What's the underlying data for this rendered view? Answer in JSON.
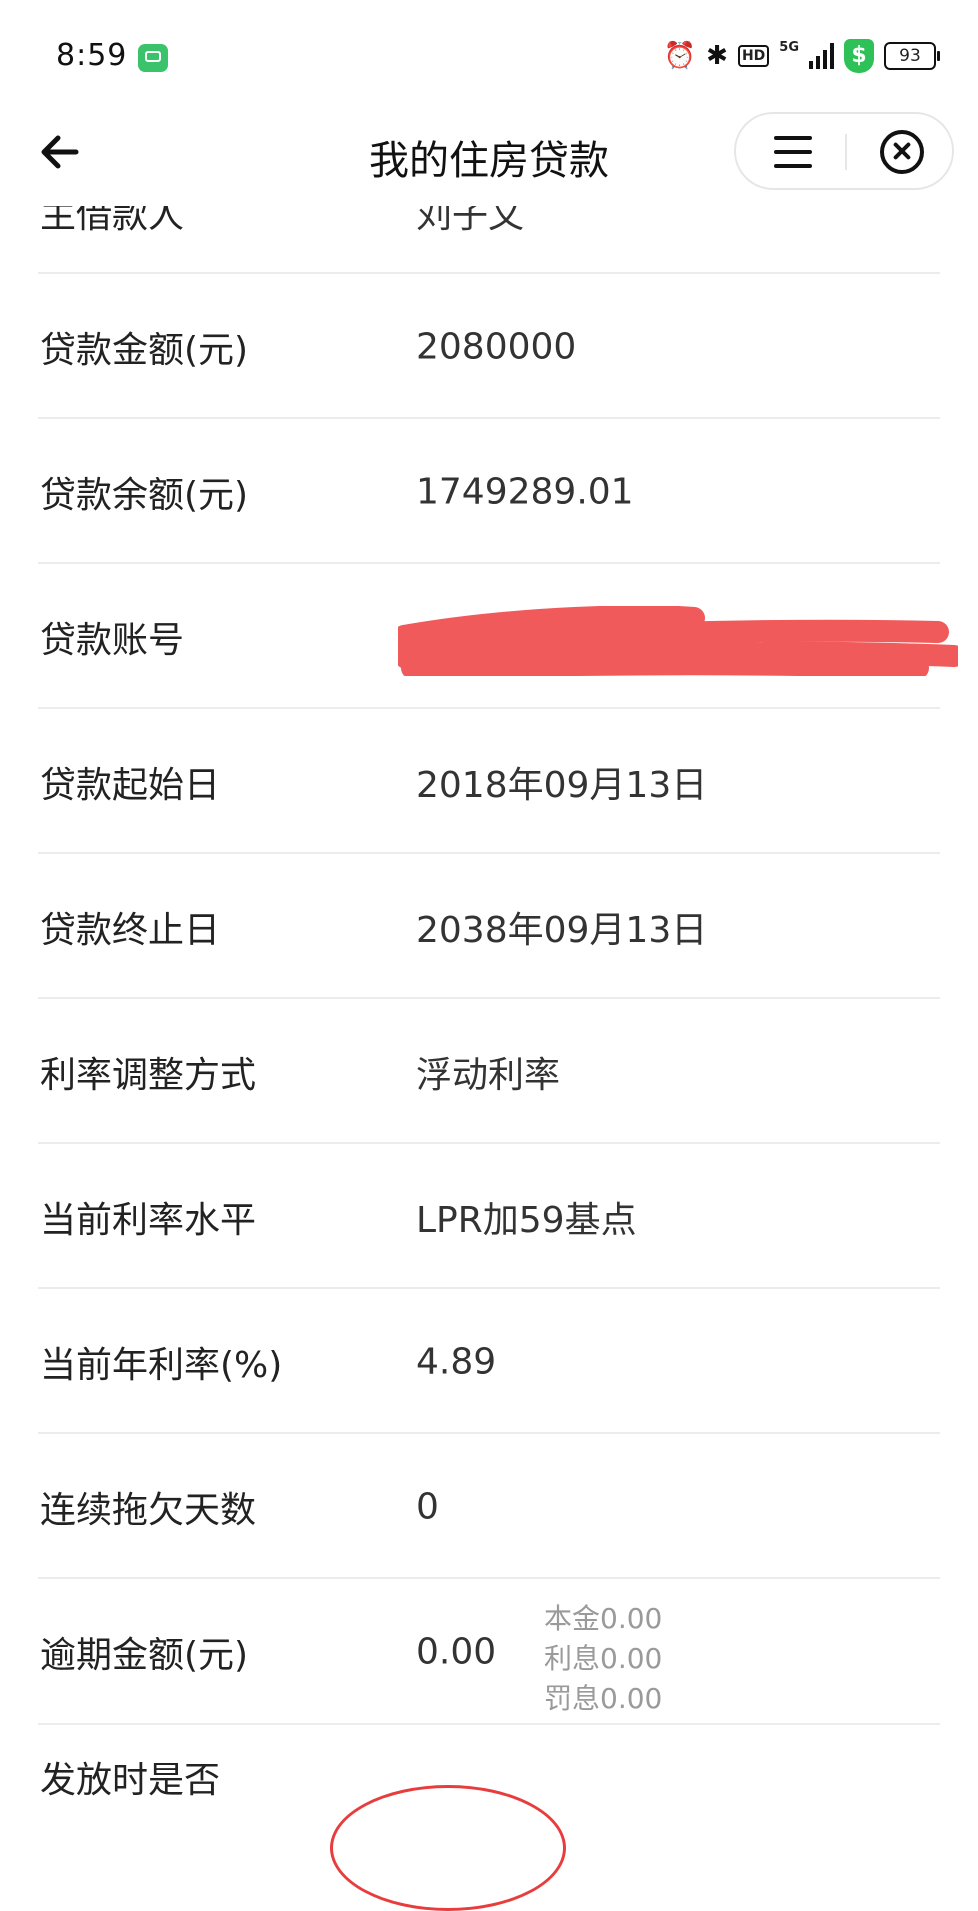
{
  "status_bar": {
    "time": "8:59",
    "hd": "HD",
    "network": "5G",
    "battery": "93",
    "shield_symbol": "$"
  },
  "nav": {
    "title": "我的住房贷款"
  },
  "list": {
    "partial_top": {
      "label": "主借款人",
      "value": "刘子文"
    },
    "rows": [
      {
        "label": "贷款金额(元)",
        "value": "2080000"
      },
      {
        "label": "贷款余额(元)",
        "value": "1749289.01"
      },
      {
        "label": "贷款账号",
        "value": ""
      },
      {
        "label": "贷款起始日",
        "value": "2018年09月13日"
      },
      {
        "label": "贷款终止日",
        "value": "2038年09月13日"
      },
      {
        "label": "利率调整方式",
        "value": "浮动利率"
      },
      {
        "label": "当前利率水平",
        "value": "LPR加59基点"
      },
      {
        "label": "当前年利率(%)",
        "value": "4.89"
      },
      {
        "label": "连续拖欠天数",
        "value": "0"
      }
    ],
    "overdue": {
      "label": "逾期金额(元)",
      "value": "0.00",
      "principal": "本金0.00",
      "interest": "利息0.00",
      "penalty": "罚息0.00"
    },
    "last": {
      "label": "发放时是否"
    }
  },
  "colors": {
    "redaction": "#f05a5a",
    "circle": "#e83d3d",
    "divider": "#ececec",
    "shield": "#2ec158",
    "message_app": "#3ac36b"
  },
  "icons": [
    "back-arrow-icon",
    "menu-icon",
    "close-icon",
    "alarm-icon",
    "bluetooth-icon",
    "signal-icon",
    "shield-icon",
    "battery-icon",
    "message-app-icon"
  ]
}
